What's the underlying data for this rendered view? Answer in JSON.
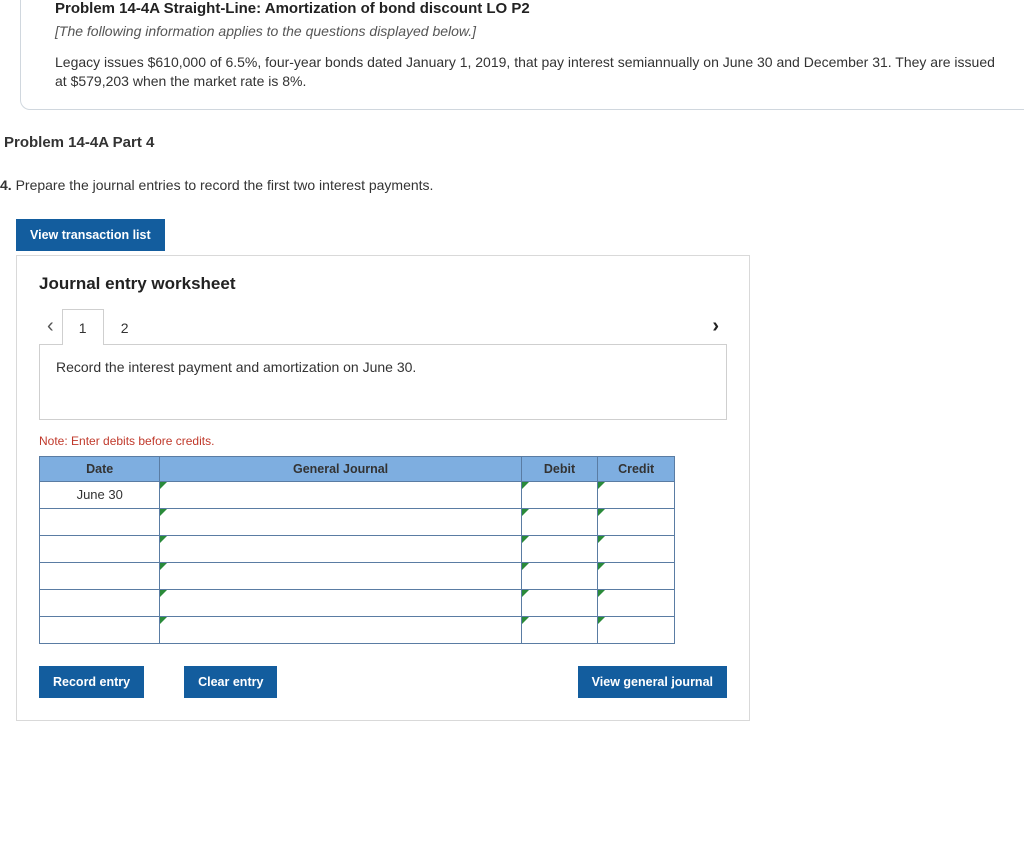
{
  "problem": {
    "title": "Problem 14-4A Straight-Line: Amortization of bond discount LO P2",
    "applies": "[The following information applies to the questions displayed below.]",
    "body": "Legacy issues $610,000 of 6.5%, four-year bonds dated January 1, 2019, that pay interest semiannually on June 30 and December 31. They are issued at $579,203 when the market rate is 8%."
  },
  "part": {
    "title": "Problem 14-4A Part 4",
    "number": "4.",
    "instruction": "Prepare the journal entries to record the first two interest payments."
  },
  "buttons": {
    "view_transaction_list": "View transaction list",
    "record_entry": "Record entry",
    "clear_entry": "Clear entry",
    "view_general_journal": "View general journal"
  },
  "worksheet": {
    "title": "Journal entry worksheet",
    "tabs": [
      "1",
      "2"
    ],
    "active_tab": 0,
    "prompt": "Record the interest payment and amortization on June 30.",
    "note": "Note: Enter debits before credits.",
    "columns": {
      "date": "Date",
      "general_journal": "General Journal",
      "debit": "Debit",
      "credit": "Credit"
    },
    "rows": [
      {
        "date": "June 30",
        "account": "",
        "debit": "",
        "credit": ""
      },
      {
        "date": "",
        "account": "",
        "debit": "",
        "credit": ""
      },
      {
        "date": "",
        "account": "",
        "debit": "",
        "credit": ""
      },
      {
        "date": "",
        "account": "",
        "debit": "",
        "credit": ""
      },
      {
        "date": "",
        "account": "",
        "debit": "",
        "credit": ""
      },
      {
        "date": "",
        "account": "",
        "debit": "",
        "credit": ""
      }
    ]
  }
}
